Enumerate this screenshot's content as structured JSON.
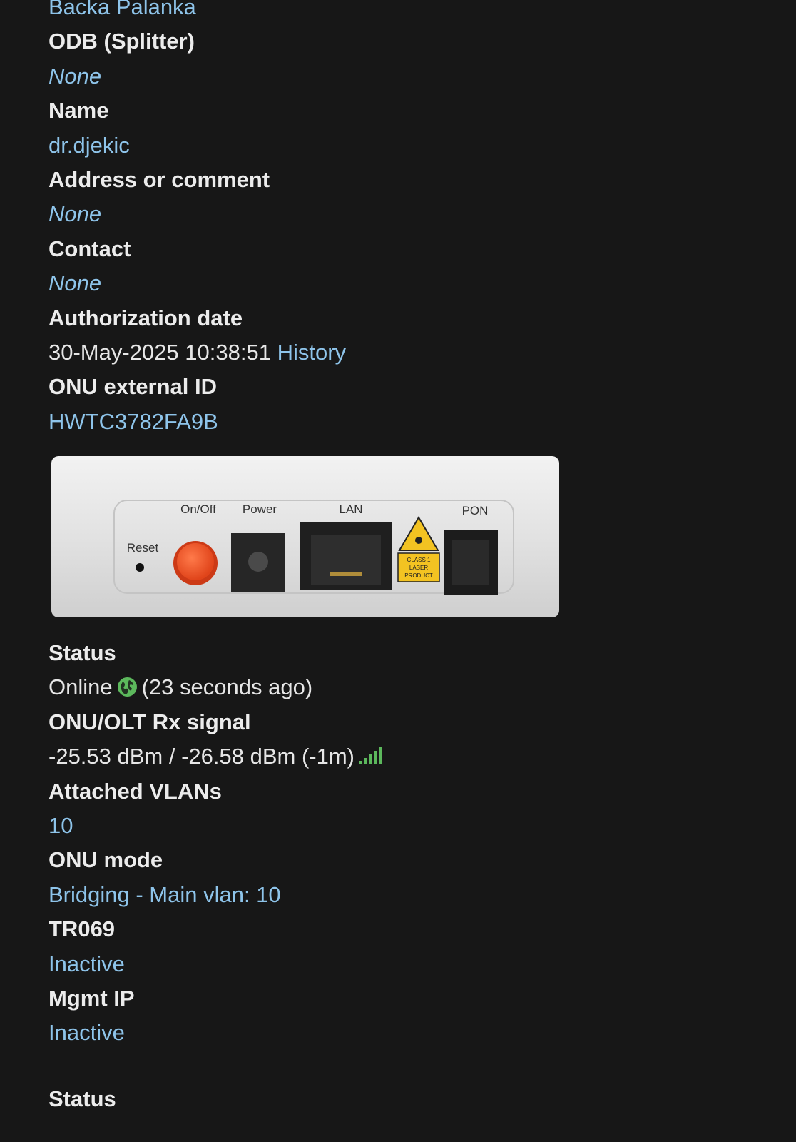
{
  "location": {
    "zone_value": "Backa Palanka"
  },
  "fields": {
    "odb_label": "ODB (Splitter)",
    "odb_value": "None",
    "name_label": "Name",
    "name_value": "dr.djekic",
    "address_label": "Address or comment",
    "address_value": "None",
    "contact_label": "Contact",
    "contact_value": "None",
    "auth_date_label": "Authorization date",
    "auth_date_value": "30-May-2025 10:38:51",
    "auth_history_link": "History",
    "external_id_label": "ONU external ID",
    "external_id_value": "HWTC3782FA9B"
  },
  "device_image": {
    "ports": {
      "reset": "Reset",
      "onoff": "On/Off",
      "power": "Power",
      "lan": "LAN",
      "pon": "PON"
    },
    "laser_label_lines": [
      "CLASS 1",
      "LASER",
      "PRODUCT"
    ]
  },
  "status": {
    "status_label": "Status",
    "status_value": "Online",
    "status_icon": "globe-icon",
    "status_icon_color": "#5cb85c",
    "status_age": "(23 seconds ago)",
    "rx_label": "ONU/OLT Rx signal",
    "rx_value": "-25.53 dBm / -26.58 dBm (-1m)",
    "rx_icon": "signal-bars-icon",
    "rx_icon_color": "#5cb85c",
    "vlans_label": "Attached VLANs",
    "vlans_value": "10",
    "mode_label": "ONU mode",
    "mode_value": "Bridging - Main vlan: 10",
    "tr069_label": "TR069",
    "tr069_value": "Inactive",
    "mgmt_ip_label": "Mgmt IP",
    "mgmt_ip_value": "Inactive",
    "bottom_status_label": "Status"
  },
  "colors": {
    "background": "#171717",
    "label": "#ececec",
    "link": "#8ec4ea"
  }
}
